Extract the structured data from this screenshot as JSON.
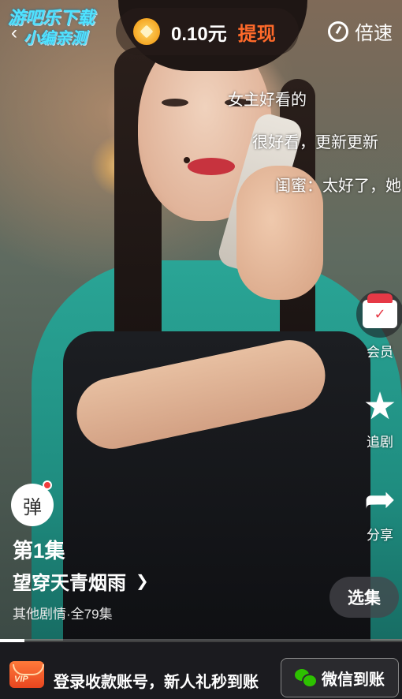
{
  "header": {
    "logo_line1": "游吧乐下载",
    "logo_line2": "小编亲测",
    "back_icon": "chevron-left-icon",
    "balance": "0.10元",
    "withdraw_label": "提现",
    "speed_label": "倍速"
  },
  "danmaku": [
    "女主好看的",
    "很好看，更新更新",
    "闺蜜：太好了，她"
  ],
  "actions": {
    "vip_label": "会员",
    "follow_label": "追剧",
    "share_label": "分享"
  },
  "info": {
    "danmu_toggle": "弹",
    "episode": "第1集",
    "title": "望穿天青烟雨",
    "meta": "其他剧情·全79集",
    "select_label": "选集"
  },
  "progress": {
    "fraction": 0.06
  },
  "banner": {
    "vip_badge": "VIP",
    "text": "登录收款账号，新人礼秒到账",
    "wechat_label": "微信到账"
  },
  "colors": {
    "withdraw": "#ff6a2a",
    "wechat": "#2dc100",
    "logo": "#4fe3ff"
  }
}
